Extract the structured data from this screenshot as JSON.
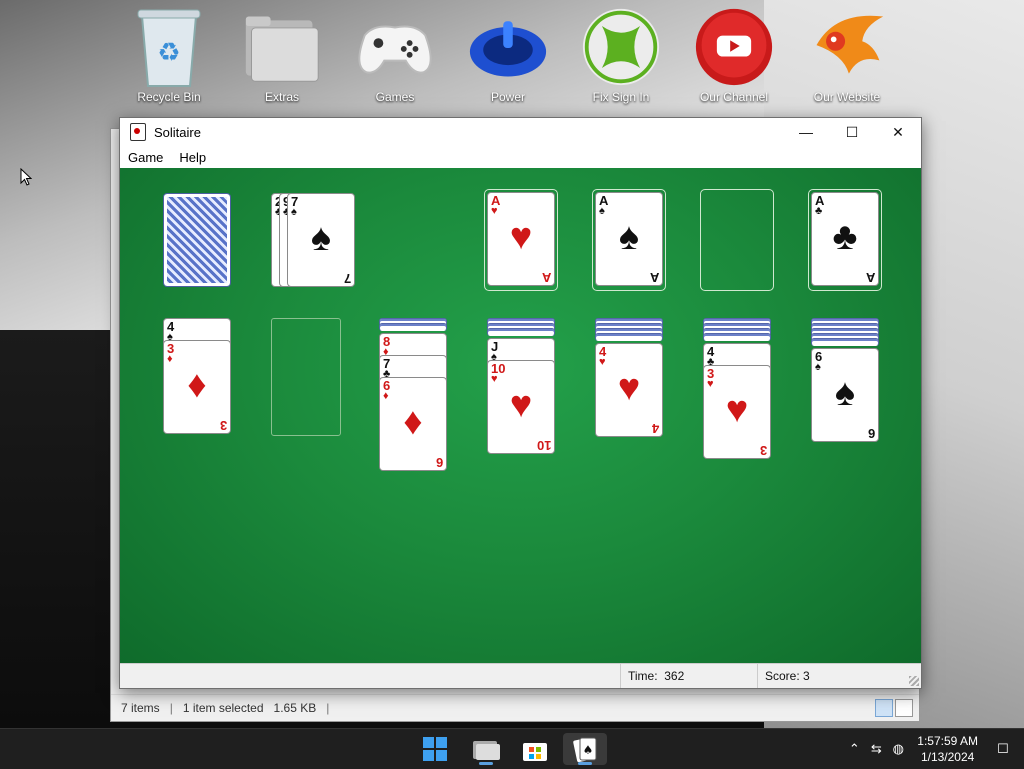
{
  "desktop": {
    "icons": [
      {
        "label": "Recycle Bin",
        "icon": "recycle-bin-icon"
      },
      {
        "label": "Extras",
        "icon": "folder-icon"
      },
      {
        "label": "Games",
        "icon": "gamepad-icon"
      },
      {
        "label": "Power",
        "icon": "power-icon"
      },
      {
        "label": "Fix Sign In",
        "icon": "xbox-icon"
      },
      {
        "label": "Our Channel",
        "icon": "youtube-icon"
      },
      {
        "label": "Our Website",
        "icon": "phoenix-icon"
      }
    ]
  },
  "explorer": {
    "items_count": "7 items",
    "selected": "1 item selected",
    "size": "1.65 KB"
  },
  "window": {
    "title": "Solitaire",
    "menu": [
      "Game",
      "Help"
    ],
    "time_label": "Time:",
    "time_value": "362",
    "score_label": "Score:",
    "score_value": "3"
  },
  "game": {
    "waste": [
      {
        "rank": "2",
        "suit": "♣",
        "color": "black"
      },
      {
        "rank": "9",
        "suit": "♣",
        "color": "black"
      },
      {
        "rank": "7",
        "suit": "♠",
        "color": "black"
      }
    ],
    "foundations": [
      {
        "rank": "A",
        "suit": "♥",
        "color": "red"
      },
      {
        "rank": "A",
        "suit": "♠",
        "color": "black"
      },
      null,
      {
        "rank": "A",
        "suit": "♣",
        "color": "black"
      }
    ],
    "tableau": [
      {
        "face_down": 0,
        "face_up": [
          {
            "rank": "4",
            "suit": "♠",
            "color": "black"
          },
          {
            "rank": "3",
            "suit": "♦",
            "color": "red"
          }
        ]
      },
      {
        "face_down": 0,
        "face_up": []
      },
      {
        "face_down": 2,
        "face_up": [
          {
            "rank": "8",
            "suit": "♦",
            "color": "red"
          },
          {
            "rank": "7",
            "suit": "♣",
            "color": "black"
          },
          {
            "rank": "6",
            "suit": "♦",
            "color": "red"
          }
        ]
      },
      {
        "face_down": 3,
        "face_up": [
          {
            "rank": "J",
            "suit": "♠",
            "color": "black"
          },
          {
            "rank": "10",
            "suit": "♥",
            "color": "red"
          }
        ]
      },
      {
        "face_down": 4,
        "face_up": [
          {
            "rank": "4",
            "suit": "♥",
            "color": "red"
          }
        ]
      },
      {
        "face_down": 4,
        "face_up": [
          {
            "rank": "4",
            "suit": "♣",
            "color": "black"
          },
          {
            "rank": "3",
            "suit": "♥",
            "color": "red"
          }
        ]
      },
      {
        "face_down": 5,
        "face_up": [
          {
            "rank": "6",
            "suit": "♠",
            "color": "black"
          }
        ]
      }
    ]
  },
  "taskbar": {
    "time": "1:57:59 AM",
    "date": "1/13/2024"
  }
}
